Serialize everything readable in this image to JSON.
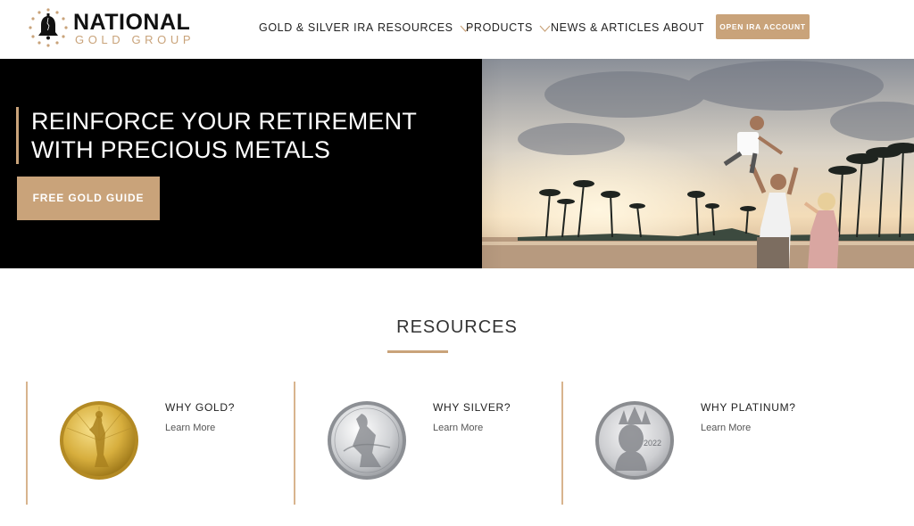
{
  "brand": {
    "name": "NATIONAL",
    "subname": "GOLD GROUP",
    "accent_color": "#c9a37a"
  },
  "nav": {
    "items": [
      {
        "label": "GOLD & SILVER IRA",
        "has_dropdown": false
      },
      {
        "label": "RESOURCES",
        "has_dropdown": true
      },
      {
        "label": "PRODUCTS",
        "has_dropdown": true
      },
      {
        "label": "NEWS & ARTICLES",
        "has_dropdown": false
      },
      {
        "label": "ABOUT",
        "has_dropdown": false
      }
    ],
    "cta_label": "OPEN IRA ACCOUNT"
  },
  "hero": {
    "title_line1": "REINFORCE YOUR RETIREMENT",
    "title_line2": "WITH PRECIOUS METALS",
    "button_label": "FREE GOLD GUIDE"
  },
  "resources": {
    "heading": "RESOURCES",
    "cards": [
      {
        "title": "WHY GOLD?",
        "link": "Learn More",
        "coin": "gold-eagle-coin"
      },
      {
        "title": "WHY SILVER?",
        "link": "Learn More",
        "coin": "silver-eagle-coin"
      },
      {
        "title": "WHY PLATINUM?",
        "link": "Learn More",
        "coin": "platinum-liberty-coin"
      }
    ]
  },
  "coin_platinum_year": "2022"
}
